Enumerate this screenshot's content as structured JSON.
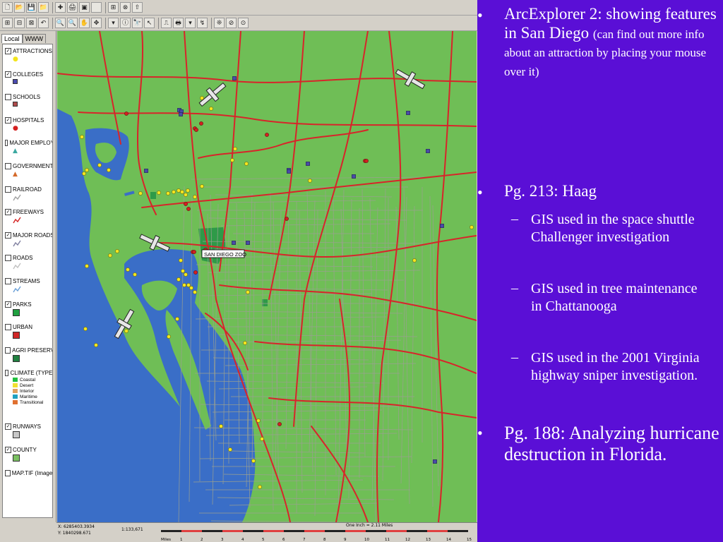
{
  "toolbar": {
    "row1": [
      "🗋",
      "📂",
      "💾",
      "📁",
      "✚",
      "🖨",
      "▣",
      "",
      "⊞",
      "⊗",
      "⇧"
    ],
    "row2": [
      "⊞",
      "⊟",
      "⊠",
      "↶",
      "🔍",
      "🔍",
      "✋",
      "✥",
      "▾",
      "ⓘ",
      "🔭",
      "↖",
      "⎍",
      "🖶",
      "▾",
      "↯",
      "❊",
      "⊘",
      "⊙"
    ]
  },
  "legend": {
    "tabs": [
      "Local",
      "WWW"
    ],
    "layers": [
      {
        "name": "ATTRACTIONS",
        "checked": true,
        "symbol": "dot",
        "color": "#f2e41c"
      },
      {
        "name": "COLLEGES",
        "checked": true,
        "symbol": "square",
        "color": "#4b4bb0"
      },
      {
        "name": "SCHOOLS",
        "checked": false,
        "symbol": "square",
        "color": "#b04b4b"
      },
      {
        "name": "HOSPITALS",
        "checked": true,
        "symbol": "dot",
        "color": "#d42020"
      },
      {
        "name": "MAJOR EMPLOY",
        "checked": false,
        "symbol": "triangle",
        "color": "#3aa8a0"
      },
      {
        "name": "GOVERNMENT",
        "checked": false,
        "symbol": "triangle",
        "color": "#d46a2a"
      },
      {
        "name": "RAILROAD",
        "checked": false,
        "symbol": "line",
        "color": "#a0a0a0"
      },
      {
        "name": "FREEWAYS",
        "checked": true,
        "symbol": "line",
        "color": "#d42020"
      },
      {
        "name": "MAJOR ROADS",
        "checked": true,
        "symbol": "line",
        "color": "#8080a0"
      },
      {
        "name": "ROADS",
        "checked": false,
        "symbol": "line",
        "color": "#c0c0c0"
      },
      {
        "name": "STREAMS",
        "checked": false,
        "symbol": "line",
        "color": "#6aa0d8"
      },
      {
        "name": "PARKS",
        "checked": true,
        "symbol": "fill",
        "color": "#20a040"
      },
      {
        "name": "URBAN",
        "checked": false,
        "symbol": "fill",
        "color": "#d02828"
      },
      {
        "name": "AGRI PRESERV",
        "checked": false,
        "symbol": "fill",
        "color": "#208040"
      }
    ],
    "climate": {
      "name": "CLIMATE (TYPE)",
      "checked": false,
      "types": [
        {
          "name": "Coastal",
          "color": "#20c040"
        },
        {
          "name": "Desert",
          "color": "#f0e030"
        },
        {
          "name": "Interior",
          "color": "#e0a060"
        },
        {
          "name": "Maritime",
          "color": "#20a0c0"
        },
        {
          "name": "Transitional",
          "color": "#e07030"
        }
      ]
    },
    "layers2": [
      {
        "name": "RUNWAYS",
        "checked": true,
        "symbol": "fill",
        "color": "#c8c8c8"
      },
      {
        "name": "COUNTY",
        "checked": true,
        "symbol": "fill",
        "color": "#7ac062"
      },
      {
        "name": "MAP.TIF (Image)",
        "checked": false,
        "symbol": "none",
        "color": ""
      }
    ]
  },
  "map": {
    "zoo_label": "SAN DIEGO ZOO",
    "colors": {
      "land": "#6fbe56",
      "water": "#3a6ec7",
      "freeway": "#d8242a",
      "road": "#9aa090",
      "park": "#2e9a48"
    }
  },
  "status": {
    "coord_x": "X: 6285403.3934",
    "coord_y": "Y: 1840298.671",
    "scale": "1:133,671",
    "scale_caption": "One Inch = 2.11 Miles",
    "scale_unit": "Miles",
    "scale_ticks": [
      "1",
      "2",
      "3",
      "4",
      "5",
      "6",
      "7",
      "8",
      "9",
      "10",
      "11",
      "12",
      "13",
      "14",
      "15"
    ]
  },
  "slide": {
    "bullets": [
      {
        "text": "ArcExplorer 2: showing features in San Diego",
        "note": "(can find out more info about an attraction by placing your mouse over it)"
      },
      {
        "text": "Pg. 213: Haag",
        "sub": [
          "GIS used in the space shuttle Challenger investigation",
          "GIS used in tree maintenance in Chattanooga",
          "GIS used in the 2001 Virginia highway sniper investigation."
        ]
      },
      {
        "text": "Pg. 188: Analyzing hurricane destruction in Florida."
      }
    ]
  }
}
